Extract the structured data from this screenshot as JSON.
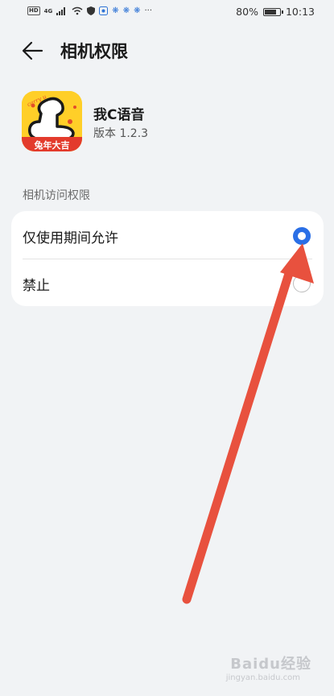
{
  "status_bar": {
    "left_badges": [
      "HD",
      "4G"
    ],
    "battery_text": "80%",
    "battery_level": 0.8,
    "time": "10:13"
  },
  "header": {
    "title": "相机权限"
  },
  "app": {
    "name": "我C语音",
    "version": "版本 1.2.3",
    "icon_banner": "兔年大吉",
    "icon_script": "carry u"
  },
  "section": {
    "label": "相机访问权限"
  },
  "options": [
    {
      "label": "仅使用期间允许",
      "selected": true
    },
    {
      "label": "禁止",
      "selected": false
    }
  ],
  "watermark": {
    "brand": "Baidu经验",
    "url": "jingyan.baidu.com"
  },
  "colors": {
    "accent": "#2a6fe6",
    "annotation_arrow": "#e8513e",
    "background": "#f1f3f5"
  }
}
